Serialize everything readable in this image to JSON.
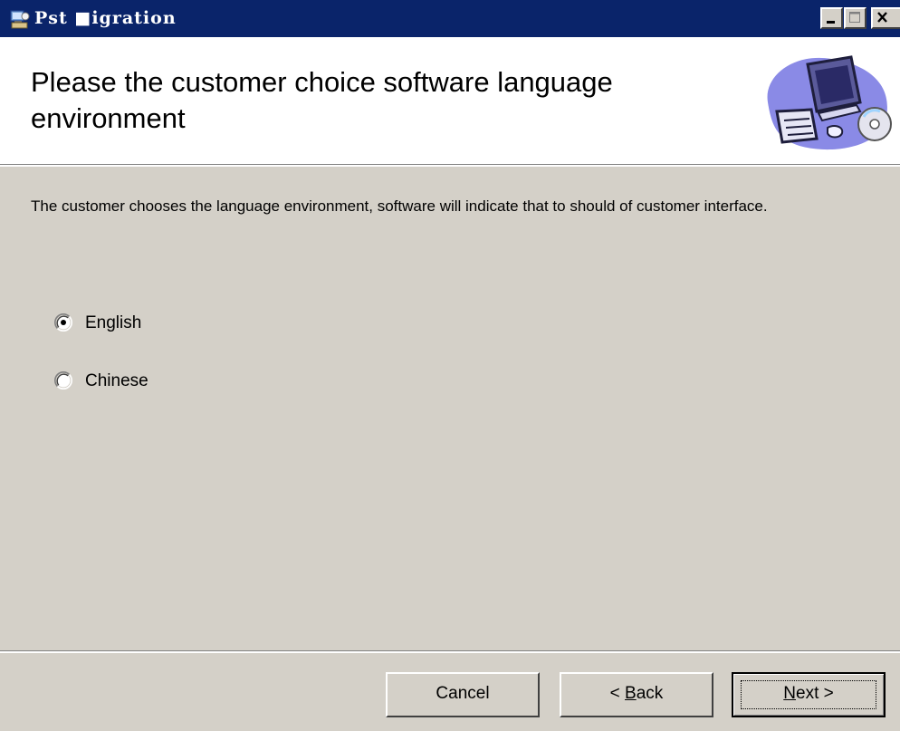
{
  "window": {
    "title": "Pst ■igration",
    "controls": {
      "minimize": "minimize-icon",
      "maximize": "maximize-icon",
      "close": "close-icon"
    }
  },
  "banner": {
    "title": "Please the customer choice software language environment",
    "art": "computer-cd-icon"
  },
  "description": "The customer chooses the language environment, software will indicate that to should of customer interface.",
  "language_options": [
    {
      "label": "English",
      "selected": true
    },
    {
      "label": "Chinese",
      "selected": false
    }
  ],
  "buttons": {
    "cancel": "Cancel",
    "back": {
      "prefix": "< ",
      "mnemonic": "B",
      "rest": "ack"
    },
    "next": {
      "mnemonic": "N",
      "rest": "ext >"
    }
  },
  "colors": {
    "titlebar": "#0a246a",
    "face": "#d4d0c8",
    "banner": "#ffffff"
  }
}
